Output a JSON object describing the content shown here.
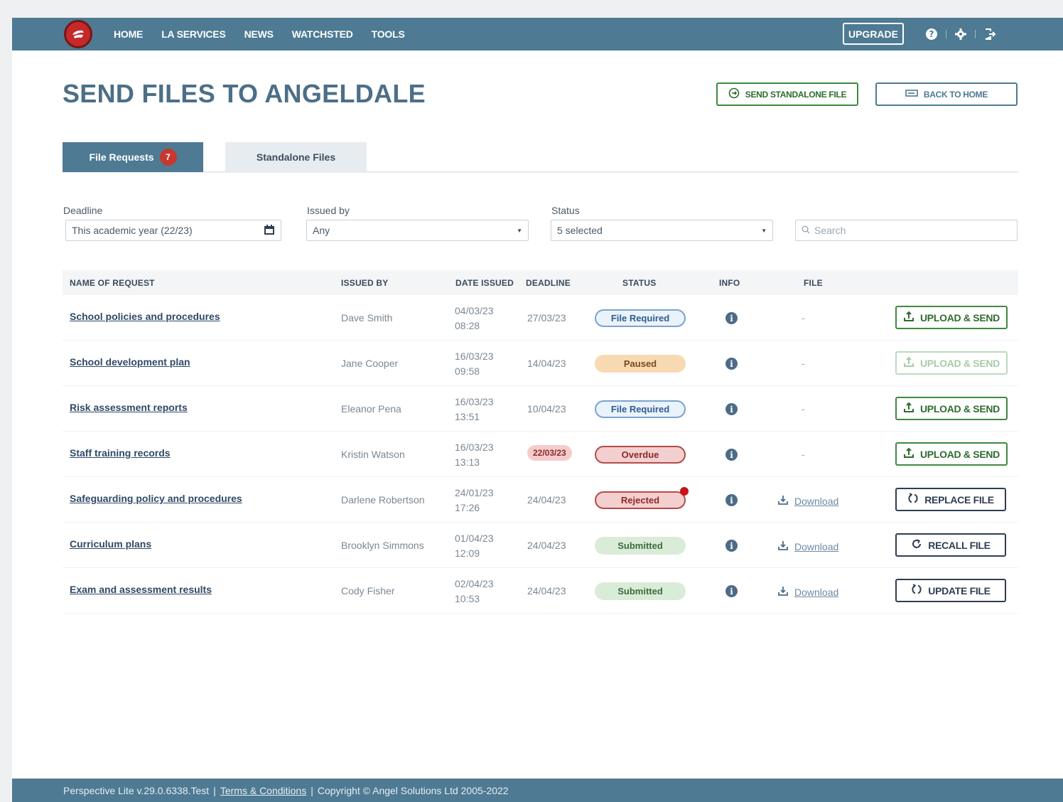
{
  "nav": {
    "links": [
      "HOME",
      "LA SERVICES",
      "NEWS",
      "WATCHSTED",
      "TOOLS"
    ],
    "upgrade_label": "UPGRADE"
  },
  "header": {
    "title": "SEND FILES TO ANGELDALE",
    "send_standalone_label": "SEND STANDALONE FILE",
    "back_to_home_label": "BACK TO HOME"
  },
  "tabs": {
    "file_requests_label": "File Requests",
    "file_requests_count": "7",
    "standalone_label": "Standalone Files"
  },
  "filters": {
    "deadline_label": "Deadline",
    "deadline_value": "This academic year (22/23)",
    "issued_by_label": "Issued by",
    "issued_by_value": "Any",
    "status_label": "Status",
    "status_value": "5 selected",
    "search_placeholder": "Search"
  },
  "table": {
    "headers": {
      "name": "NAME OF REQUEST",
      "issued_by": "ISSUED BY",
      "date_issued": "DATE ISSUED",
      "deadline": "DEADLINE",
      "status": "STATUS",
      "info": "INFO",
      "file": "FILE"
    },
    "rows": [
      {
        "name": "School policies and procedures",
        "issued_by": "Dave Smith",
        "date": "04/03/23",
        "time": "08:28",
        "deadline": "27/03/23",
        "status": "File Required",
        "file": "-",
        "action": "UPLOAD & SEND"
      },
      {
        "name": "School development plan",
        "issued_by": "Jane Cooper",
        "date": "16/03/23",
        "time": "09:58",
        "deadline": "14/04/23",
        "status": "Paused",
        "file": "-",
        "action": "UPLOAD & SEND"
      },
      {
        "name": "Risk assessment reports",
        "issued_by": "Eleanor Pena",
        "date": "16/03/23",
        "time": "13:51",
        "deadline": "10/04/23",
        "status": "File Required",
        "file": "-",
        "action": "UPLOAD & SEND"
      },
      {
        "name": "Staff training records",
        "issued_by": "Kristin Watson",
        "date": "16/03/23",
        "time": "13:13",
        "deadline": "22/03/23",
        "status": "Overdue",
        "file": "-",
        "action": "UPLOAD & SEND"
      },
      {
        "name": "Safeguarding policy and procedures",
        "issued_by": "Darlene Robertson",
        "date": "24/01/23",
        "time": "17:26",
        "deadline": "24/04/23",
        "status": "Rejected",
        "file": "Download",
        "action": "REPLACE FILE"
      },
      {
        "name": "Curriculum plans",
        "issued_by": "Brooklyn Simmons",
        "date": "01/04/23",
        "time": "12:09",
        "deadline": "24/04/23",
        "status": "Submitted",
        "file": "Download",
        "action": "RECALL FILE"
      },
      {
        "name": "Exam and assessment results",
        "issued_by": "Cody Fisher",
        "date": "02/04/23",
        "time": "10:53",
        "deadline": "24/04/23",
        "status": "Submitted",
        "file": "Download",
        "action": "UPDATE FILE"
      }
    ]
  },
  "footer": {
    "version": "Perspective Lite v.29.0.6338.Test",
    "sep1": "|",
    "terms": "Terms & Conditions",
    "sep2": "|",
    "copyright": "Copyright © Angel Solutions Ltd 2005-2022"
  },
  "colors": {
    "nav": "#4e7a93",
    "title": "#4c6f86",
    "green": "#3e8a3e",
    "badge": "#c8372d"
  },
  "icons": [
    "logo-icon",
    "help-icon",
    "gear-icon",
    "logout-icon",
    "calendar-icon",
    "search-icon",
    "info-icon",
    "download-icon",
    "upload-icon",
    "replace-icon",
    "recall-icon",
    "update-icon",
    "send-icon",
    "back-icon"
  ]
}
